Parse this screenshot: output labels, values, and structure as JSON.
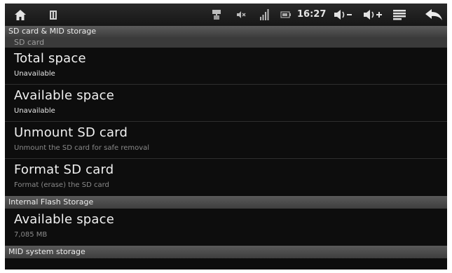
{
  "status_bar": {
    "time": "16:27",
    "icons": [
      "home-icon",
      "notification-icon",
      "usb-icon",
      "mute-icon",
      "signal-icon",
      "battery-icon",
      "volume-down-icon",
      "volume-up-icon",
      "menu-icon",
      "back-icon"
    ]
  },
  "sections": {
    "sd": {
      "header": "SD card & MID storage",
      "subheader": "SD card"
    },
    "internal": {
      "header": "Internal Flash Storage"
    },
    "mid": {
      "header": "MID system storage"
    }
  },
  "items": {
    "total_space": {
      "title": "Total space",
      "summary": "Unavailable"
    },
    "available_space_sd": {
      "title": "Available space",
      "summary": "Unavailable"
    },
    "unmount": {
      "title": "Unmount SD card",
      "summary": "Unmount the SD card for safe removal"
    },
    "format": {
      "title": "Format SD card",
      "summary": "Format (erase) the SD card"
    },
    "available_space_internal": {
      "title": "Available space",
      "summary": "7,085 MB"
    }
  }
}
